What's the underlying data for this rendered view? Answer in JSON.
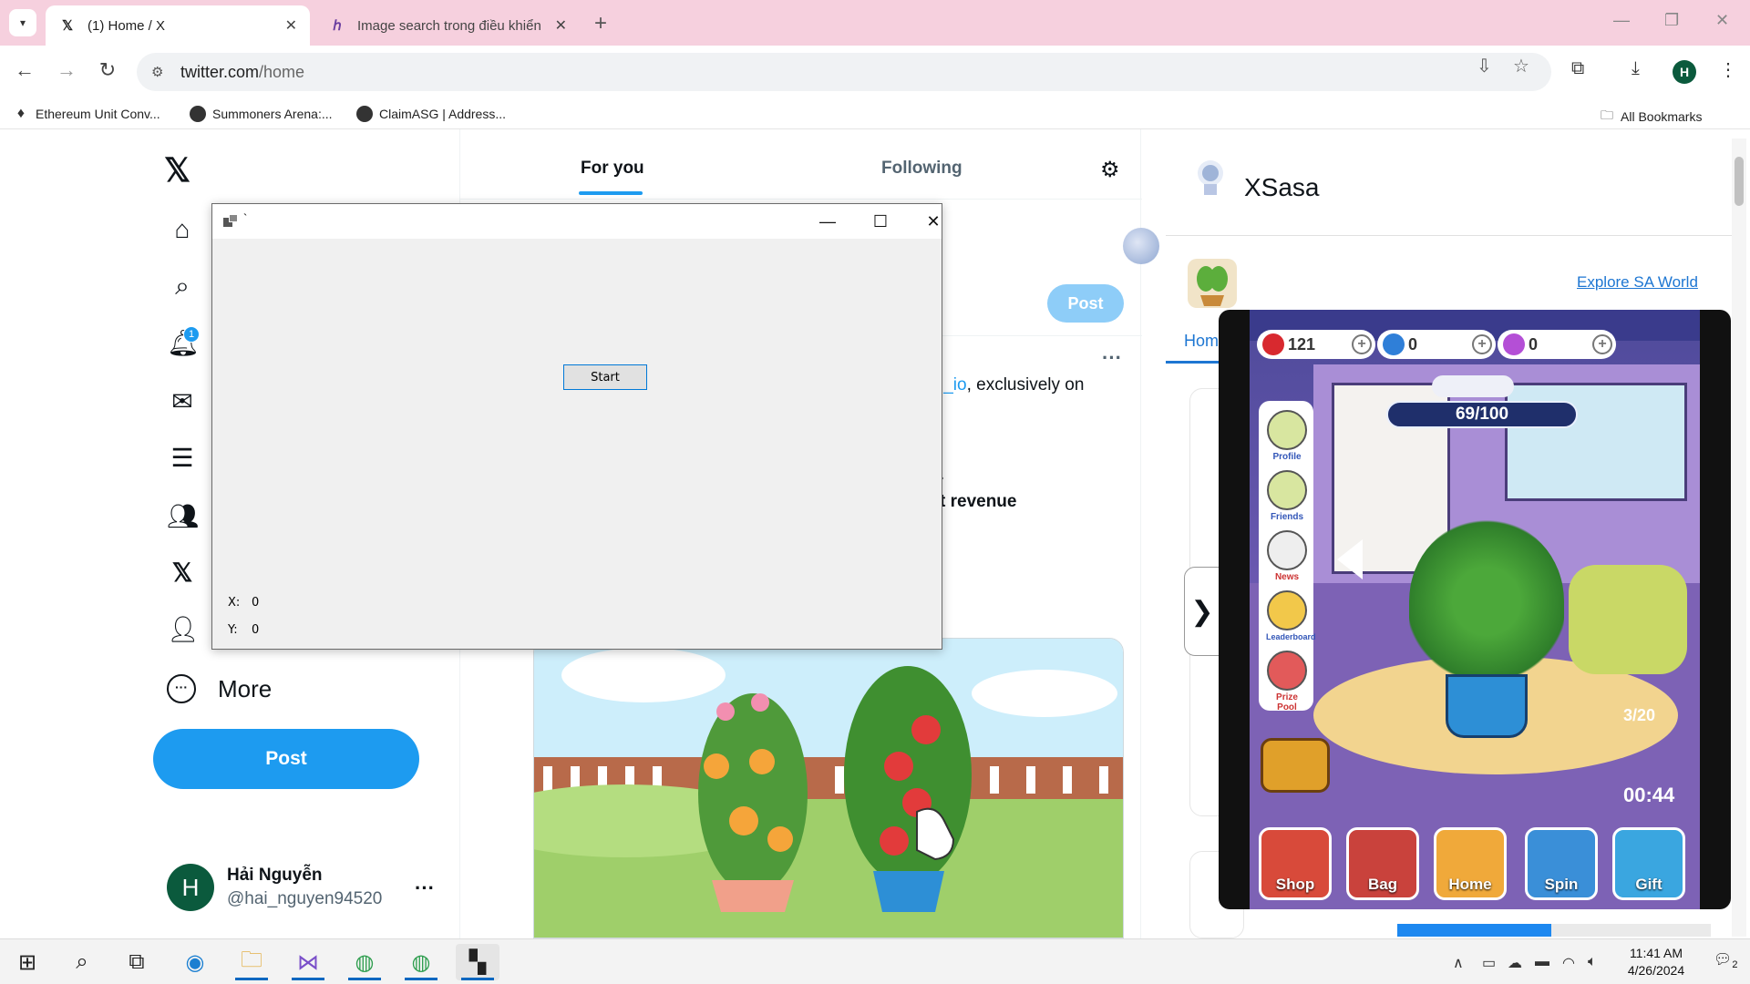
{
  "browser": {
    "tabs": [
      {
        "title": "(1) Home / X",
        "favicon": "x-logo-icon",
        "active": true
      },
      {
        "title": "Image search trong điều khiển",
        "favicon": "perplexity-icon",
        "active": false
      }
    ],
    "new_tab_symbol": "+",
    "url_host": "twitter.com",
    "url_path": "/home",
    "profile_initial": "H",
    "bookmarks": [
      {
        "label": "Ethereum Unit Conv..."
      },
      {
        "label": "Summoners Arena:..."
      },
      {
        "label": "ClaimASG | Address..."
      }
    ],
    "all_bookmarks_label": "All Bookmarks"
  },
  "twitter_nav": {
    "items": [
      "home-icon",
      "search-icon",
      "bell-icon",
      "mail-icon",
      "lists-icon",
      "communities-icon",
      "x-premium-icon",
      "profile-icon"
    ],
    "notification_badge": "1",
    "more_label": "More",
    "post_label": "Post",
    "account": {
      "avatar_initial": "H",
      "display_name": "Hải Nguyễn",
      "handle": "@hai_nguyen94520"
    }
  },
  "timeline": {
    "tab_for_you": "For you",
    "tab_following": "Following",
    "post_button": "Post",
    "tweet_link_text": "l_io",
    "tweet_text": ", exclusively on",
    "tweet_bold_fragment": "t revenue",
    "tweet_dot": "."
  },
  "right_panel": {
    "title": "XSasa",
    "explore_link": "Explore SA World",
    "tab_label": "Hom",
    "progress_fraction": 0.49
  },
  "game": {
    "resources": [
      {
        "value": "121",
        "color": "#d8292f"
      },
      {
        "value": "0",
        "color": "#2f7fd8"
      },
      {
        "value": "0",
        "color": "#b44fd6"
      }
    ],
    "water": "69/100",
    "menu": [
      "Profile",
      "Friends",
      "News",
      "Leaderboard",
      "Prize Pool"
    ],
    "counter": "3/20",
    "timer": "00:44",
    "bottom_buttons": [
      {
        "label": "Shop",
        "color": "#d84a3a"
      },
      {
        "label": "Bag",
        "color": "#c9423c"
      },
      {
        "label": "Home",
        "color": "#f0a93a"
      },
      {
        "label": "Spin",
        "color": "#3a8fd8"
      },
      {
        "label": "Gift",
        "color": "#3aa6e0"
      }
    ]
  },
  "app_window": {
    "title": "`",
    "start_label": "Start",
    "x_label": "X:",
    "x_value": "0",
    "y_label": "Y:",
    "y_value": "0"
  },
  "taskbar": {
    "time": "11:41 AM",
    "date": "4/26/2024",
    "notification_count": "2"
  }
}
